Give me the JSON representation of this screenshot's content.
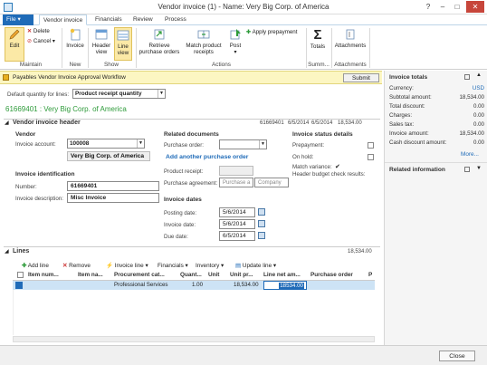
{
  "window": {
    "title": "Vendor invoice (1) - Name: Very Big Corp. of America",
    "help": "?",
    "minimize": "–",
    "maximize": "□",
    "close": "✕"
  },
  "ribbon_tabs": {
    "file": "File ▾",
    "vendor_invoice": "Vendor invoice",
    "financials": "Financials",
    "review": "Review",
    "process": "Process"
  },
  "ribbon": {
    "edit": "Edit",
    "delete": "Delete",
    "cancel": "Cancel ▾",
    "maintain": "Maintain",
    "invoice": "Invoice",
    "new": "New",
    "header_view_1": "Header",
    "header_view_2": "view",
    "line_view_1": "Line",
    "line_view_2": "view",
    "show": "Show",
    "retrieve_1": "Retrieve",
    "retrieve_2": "purchase orders",
    "match_1": "Match product",
    "match_2": "receipts",
    "post": "Post",
    "post_arrow": "▾",
    "apply_prepayment": "Apply prepayment",
    "actions": "Actions",
    "totals": "Totals",
    "summ": "Summ...",
    "attachments_btn": "Attachments",
    "attachments_grp": "Attachments"
  },
  "workflow": {
    "label": "Payables Vendor Invoice Approval Workflow",
    "submit": "Submit"
  },
  "default_qty": {
    "label": "Default quantity for lines:",
    "value": "Product receipt quantity"
  },
  "record_title": "61669401 : Very Big Corp. of America",
  "header_section": {
    "title": "Vendor invoice header",
    "summary": [
      "61669401",
      "6/5/2014",
      "6/5/2014",
      "18,534.00"
    ],
    "vendor_label": "Vendor",
    "invoice_account_label": "Invoice account:",
    "invoice_account_value": "100008",
    "vendor_name": "Very Big Corp. of America",
    "invoice_id_label": "Invoice identification",
    "number_label": "Number:",
    "number_value": "61669401",
    "description_label": "Invoice description:",
    "description_value": "Misc Invoice",
    "related_docs_label": "Related documents",
    "purchase_order_label": "Purchase order:",
    "add_po_link": "Add another purchase order",
    "product_receipt_label": "Product receipt:",
    "purchase_agreement_label": "Purchase agreement:",
    "purchase_agreement_ph1": "Purchase a",
    "purchase_agreement_ph2": "Company",
    "invoice_dates_label": "Invoice dates",
    "posting_date_label": "Posting date:",
    "posting_date_value": "5/6/2014",
    "invoice_date_label": "Invoice date:",
    "invoice_date_value": "5/6/2014",
    "due_date_label": "Due date:",
    "due_date_value": "6/5/2014",
    "status_label": "Invoice status details",
    "prepayment_label": "Prepayment:",
    "on_hold_label": "On hold:",
    "match_variance_label": "Match variance:",
    "match_variance_icon": "✔",
    "budget_check_label": "Header budget check results:"
  },
  "factbox": {
    "title": "Invoice totals",
    "rows": [
      {
        "label": "Currency:",
        "value": "USD"
      },
      {
        "label": "Subtotal amount:",
        "value": "18,534.00"
      },
      {
        "label": "Total discount:",
        "value": "0.00"
      },
      {
        "label": "Charges:",
        "value": "0.00"
      },
      {
        "label": "Sales tax:",
        "value": "0.00"
      },
      {
        "label": "Invoice amount:",
        "value": "18,534.00"
      },
      {
        "label": "Cash discount amount:",
        "value": "0.00"
      }
    ],
    "more": "More...",
    "related_info": "Related information"
  },
  "lines": {
    "title": "Lines",
    "total": "18,534.00",
    "toolbar": {
      "add_line": "Add line",
      "remove": "Remove",
      "invoice_line": "Invoice line ▾",
      "financials": "Financials ▾",
      "inventory": "Inventory ▾",
      "update_line": "Update line ▾"
    },
    "columns": [
      "Item num...",
      "Item na...",
      "Procurement cat...",
      "Quant...",
      "Unit",
      "Unit pr...",
      "Line net am...",
      "Purchase order",
      "P"
    ],
    "rows": [
      {
        "procurement": "Professional Services",
        "quantity": "1.00",
        "unit_price": "18,534.00",
        "line_net": "18534.00"
      }
    ]
  },
  "footer": {
    "close": "Close"
  },
  "colors": {
    "accent": "#1f6bb8",
    "workflow_bg": "#fcf6c2",
    "record_title": "#2e9b3a",
    "selected_row": "#cde3f5"
  }
}
